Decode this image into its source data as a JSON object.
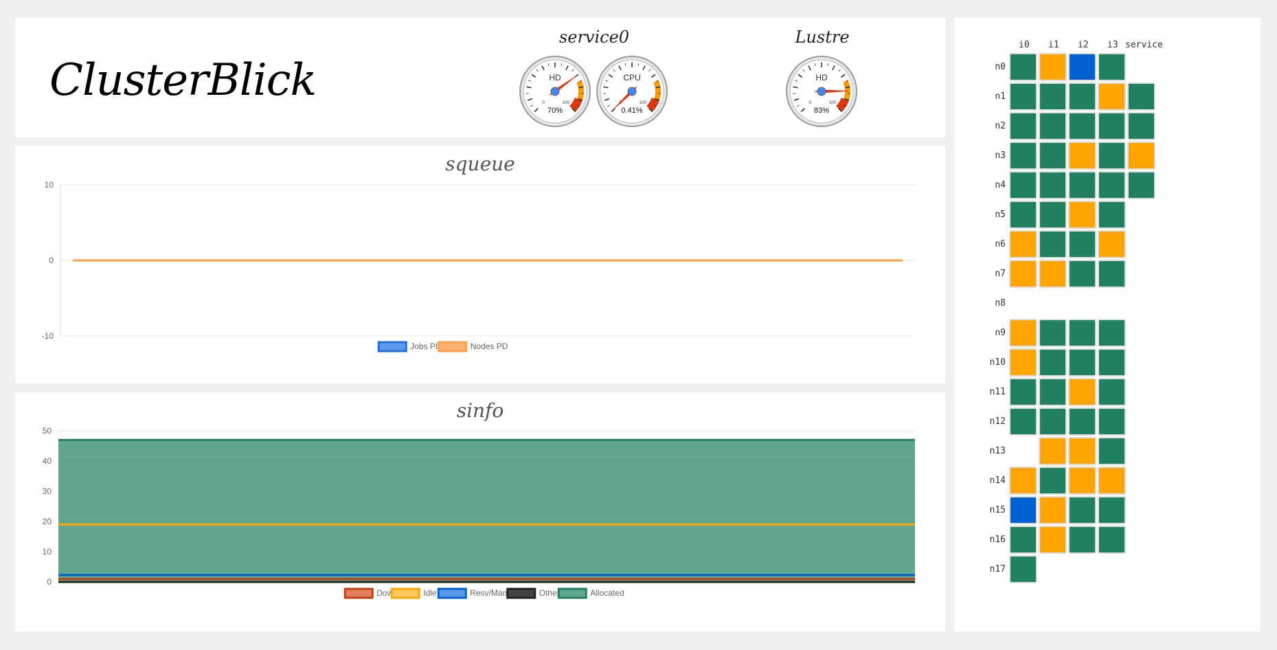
{
  "app": {
    "title": "ClusterBlick"
  },
  "colors": {
    "allocated": "#208060",
    "idle": "#ffa500",
    "resv": "#0060d0",
    "down": "#c04010",
    "other": "#222222",
    "jobs_pd": "#1f6fd6",
    "nodes_pd": "#ffa050"
  },
  "gauge_groups": [
    {
      "title": "service0",
      "gauges": [
        {
          "label": "HD",
          "value_text": "70%",
          "value": 70,
          "min": "0",
          "max": "100"
        },
        {
          "label": "CPU",
          "value_text": "0.41%",
          "value": 0.41,
          "min": "0",
          "max": "100"
        }
      ]
    },
    {
      "title": "Lustre",
      "gauges": [
        {
          "label": "HD",
          "value_text": "83%",
          "value": 83,
          "min": "0",
          "max": "100"
        }
      ]
    }
  ],
  "chart_data": [
    {
      "type": "line",
      "title": "squeue",
      "ylim": [
        -10,
        10
      ],
      "yticks": [
        "10",
        "0",
        "-10"
      ],
      "grid": true,
      "legend": "bottom-center",
      "series": [
        {
          "name": "Jobs PD",
          "values": [
            0,
            0
          ]
        },
        {
          "name": "Nodes PD",
          "values": [
            0,
            0
          ]
        }
      ]
    },
    {
      "type": "area",
      "title": "sinfo",
      "ylim": [
        0,
        50
      ],
      "yticks": [
        "0",
        "10",
        "20",
        "30",
        "40",
        "50"
      ],
      "grid": true,
      "legend": "bottom-center",
      "stacked": true,
      "series": [
        {
          "name": "Down",
          "values": [
            1,
            1
          ]
        },
        {
          "name": "Idle",
          "values": [
            19,
            19
          ]
        },
        {
          "name": "Resv/Mant",
          "values": [
            2.3,
            2.3
          ]
        },
        {
          "name": "Other",
          "values": [
            0,
            0
          ]
        },
        {
          "name": "Allocated",
          "values": [
            47,
            47
          ]
        }
      ]
    }
  ],
  "node_grid": {
    "columns": [
      "i0",
      "i1",
      "i2",
      "i3",
      "service"
    ],
    "rows": [
      {
        "name": "n0",
        "cells": [
          "A",
          "I",
          "R",
          "A",
          ""
        ]
      },
      {
        "name": "n1",
        "cells": [
          "A",
          "A",
          "A",
          "I",
          "A"
        ]
      },
      {
        "name": "n2",
        "cells": [
          "A",
          "A",
          "A",
          "A",
          "A"
        ]
      },
      {
        "name": "n3",
        "cells": [
          "A",
          "A",
          "I",
          "A",
          "I"
        ]
      },
      {
        "name": "n4",
        "cells": [
          "A",
          "A",
          "A",
          "A",
          "A"
        ]
      },
      {
        "name": "n5",
        "cells": [
          "A",
          "A",
          "I",
          "A",
          ""
        ]
      },
      {
        "name": "n6",
        "cells": [
          "I",
          "A",
          "A",
          "I",
          ""
        ]
      },
      {
        "name": "n7",
        "cells": [
          "I",
          "I",
          "A",
          "A",
          ""
        ]
      },
      {
        "name": "n8",
        "cells": [
          "",
          "",
          "",
          "",
          ""
        ]
      },
      {
        "name": "n9",
        "cells": [
          "I",
          "A",
          "A",
          "A",
          ""
        ]
      },
      {
        "name": "n10",
        "cells": [
          "I",
          "A",
          "A",
          "A",
          ""
        ]
      },
      {
        "name": "n11",
        "cells": [
          "A",
          "A",
          "I",
          "A",
          ""
        ]
      },
      {
        "name": "n12",
        "cells": [
          "A",
          "A",
          "A",
          "A",
          ""
        ]
      },
      {
        "name": "n13",
        "cells": [
          "",
          "I",
          "I",
          "A",
          ""
        ]
      },
      {
        "name": "n14",
        "cells": [
          "I",
          "A",
          "I",
          "I",
          ""
        ]
      },
      {
        "name": "n15",
        "cells": [
          "R",
          "I",
          "A",
          "A",
          ""
        ]
      },
      {
        "name": "n16",
        "cells": [
          "A",
          "I",
          "A",
          "A",
          ""
        ]
      },
      {
        "name": "n17",
        "cells": [
          "A",
          "",
          "",
          "",
          ""
        ]
      }
    ]
  }
}
